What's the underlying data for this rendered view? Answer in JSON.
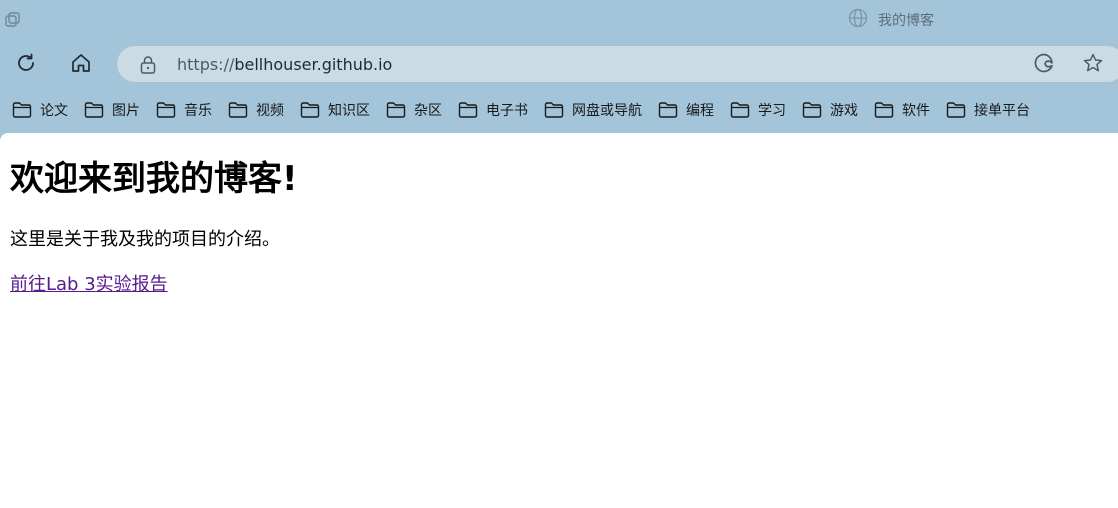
{
  "window": {
    "tab_title": "我的博客"
  },
  "toolbar": {
    "url_scheme": "https://",
    "url_host": "bellhouser.github.io"
  },
  "bookmarks": [
    {
      "label": "论文"
    },
    {
      "label": "图片"
    },
    {
      "label": "音乐"
    },
    {
      "label": "视频"
    },
    {
      "label": "知识区"
    },
    {
      "label": "杂区"
    },
    {
      "label": "电子书"
    },
    {
      "label": "网盘或导航"
    },
    {
      "label": "编程"
    },
    {
      "label": "学习"
    },
    {
      "label": "游戏"
    },
    {
      "label": "软件"
    },
    {
      "label": "接单平台"
    }
  ],
  "page": {
    "heading": "欢迎来到我的博客!",
    "intro": "这里是关于我及我的项目的介绍。",
    "link_text": "前往Lab 3实验报告"
  },
  "colors": {
    "chrome_bg": "#a3c4d9",
    "address_bg": "#c9dce6",
    "visited_link": "#551a8b"
  },
  "icons": [
    "tab-actions-icon",
    "globe-icon",
    "refresh-icon",
    "home-icon",
    "lock-icon",
    "edge-icon",
    "favorite-star-icon",
    "folder-icon"
  ]
}
